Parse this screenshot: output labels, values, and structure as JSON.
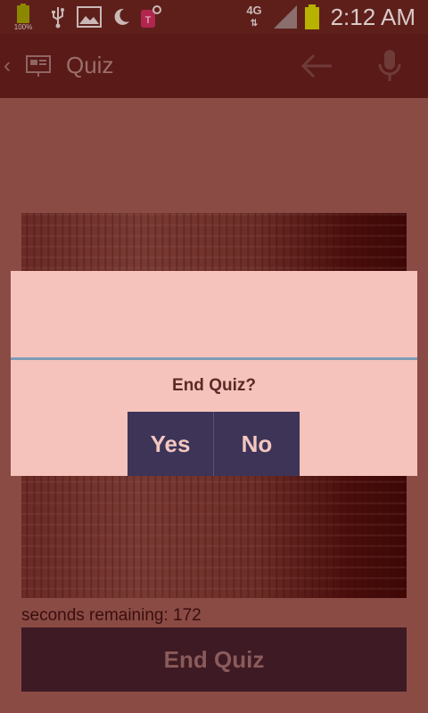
{
  "status_bar": {
    "battery_small_label": "100%",
    "network": "4G",
    "time": "2:12 AM",
    "icons": [
      "battery-small-icon",
      "usb-icon",
      "gallery-icon",
      "moon-icon",
      "tmobile-icon",
      "signal-icon",
      "battery-icon"
    ]
  },
  "action_bar": {
    "title": "Quiz",
    "icons": [
      "back-chevron-icon",
      "app-icon",
      "back-arrow-icon",
      "microphone-icon"
    ]
  },
  "content": {
    "seconds_label": "seconds remaining: 172",
    "end_quiz_label": "End Quiz"
  },
  "dialog": {
    "message": "End Quiz?",
    "yes_label": "Yes",
    "no_label": "No"
  },
  "colors": {
    "background": "#8a4b45",
    "status_bar": "#5e1f1b",
    "action_bar": "#5a1a17",
    "dialog": "#f5c3bc",
    "dialog_button": "#3d3458",
    "divider": "#7f9bb6",
    "end_button": "#3e1a24",
    "battery": "#b7b200"
  }
}
